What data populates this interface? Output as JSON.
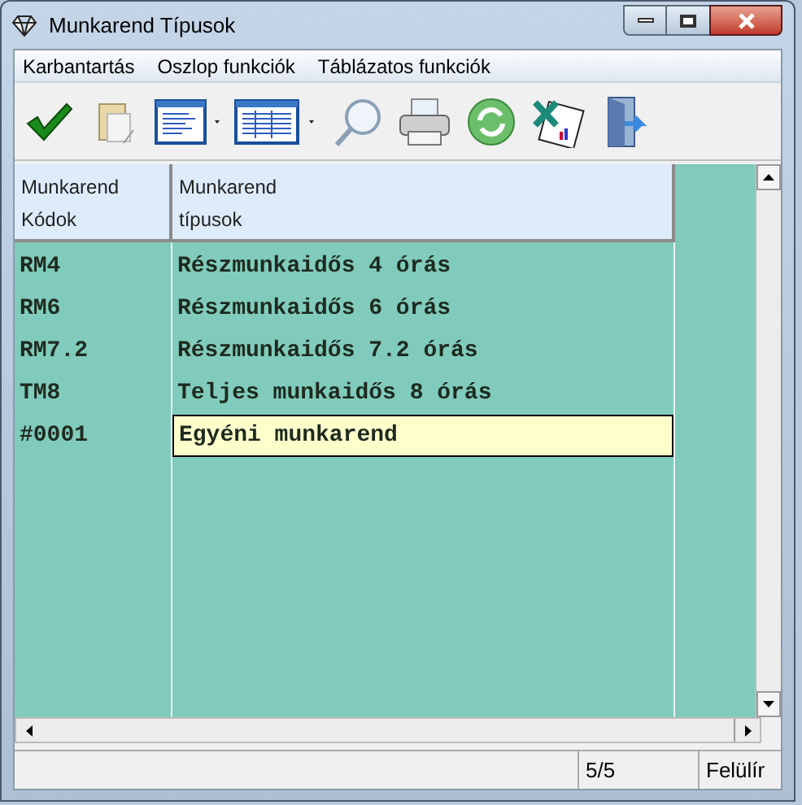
{
  "window": {
    "title": "Munkarend Típusok"
  },
  "menu": [
    "Karbantartás",
    "Oszlop funkciók",
    "Táblázatos funkciók"
  ],
  "table": {
    "columns": [
      [
        "Munkarend",
        "Kódok"
      ],
      [
        "Munkarend",
        "típusok"
      ]
    ],
    "rows": [
      {
        "code": "RM4",
        "type": "Részmunkaidős 4 órás",
        "selected": false
      },
      {
        "code": "RM6",
        "type": "Részmunkaidős 6 órás",
        "selected": false
      },
      {
        "code": "RM7.2",
        "type": "Részmunkaidős 7.2 órás",
        "selected": false
      },
      {
        "code": "TM8",
        "type": "Teljes munkaidős 8 órás",
        "selected": false
      },
      {
        "code": "#0001",
        "type": "Egyéni munkarend",
        "selected": true
      }
    ]
  },
  "status_bar": {
    "count": "5/5",
    "mode": "Felülír"
  }
}
